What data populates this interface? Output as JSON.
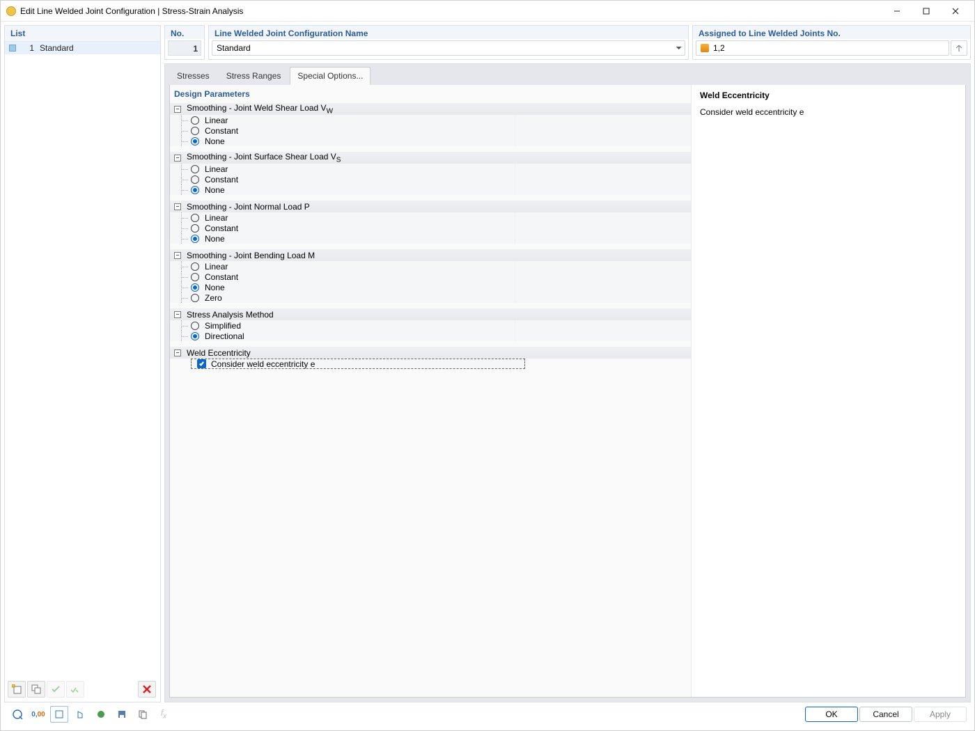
{
  "window": {
    "title": "Edit Line Welded Joint Configuration | Stress-Strain Analysis"
  },
  "list": {
    "header": "List",
    "items": [
      {
        "index": "1",
        "name": "Standard"
      }
    ]
  },
  "number": {
    "label": "No.",
    "value": "1"
  },
  "config_name": {
    "label": "Line Welded Joint Configuration Name",
    "value": "Standard"
  },
  "assigned": {
    "label": "Assigned to Line Welded Joints No.",
    "value": "1,2"
  },
  "tabs": {
    "stresses": "Stresses",
    "ranges": "Stress Ranges",
    "special": "Special Options..."
  },
  "params_header": "Design Parameters",
  "groups": {
    "vw": {
      "title": "Smoothing - Joint Weld Shear Load V",
      "sub": "W",
      "opts": {
        "linear": "Linear",
        "constant": "Constant",
        "none": "None"
      }
    },
    "vs": {
      "title": "Smoothing - Joint Surface Shear Load V",
      "sub": "S",
      "opts": {
        "linear": "Linear",
        "constant": "Constant",
        "none": "None"
      }
    },
    "p": {
      "title": "Smoothing - Joint Normal Load P",
      "opts": {
        "linear": "Linear",
        "constant": "Constant",
        "none": "None"
      }
    },
    "m": {
      "title": "Smoothing - Joint Bending Load M",
      "opts": {
        "linear": "Linear",
        "constant": "Constant",
        "none": "None",
        "zero": "Zero"
      }
    },
    "method": {
      "title": "Stress Analysis Method",
      "opts": {
        "simplified": "Simplified",
        "directional": "Directional"
      }
    },
    "ecc": {
      "title": "Weld Eccentricity",
      "opt": "Consider weld eccentricity e"
    }
  },
  "info": {
    "title": "Weld Eccentricity",
    "text": "Consider weld eccentricity e"
  },
  "buttons": {
    "ok": "OK",
    "cancel": "Cancel",
    "apply": "Apply"
  }
}
